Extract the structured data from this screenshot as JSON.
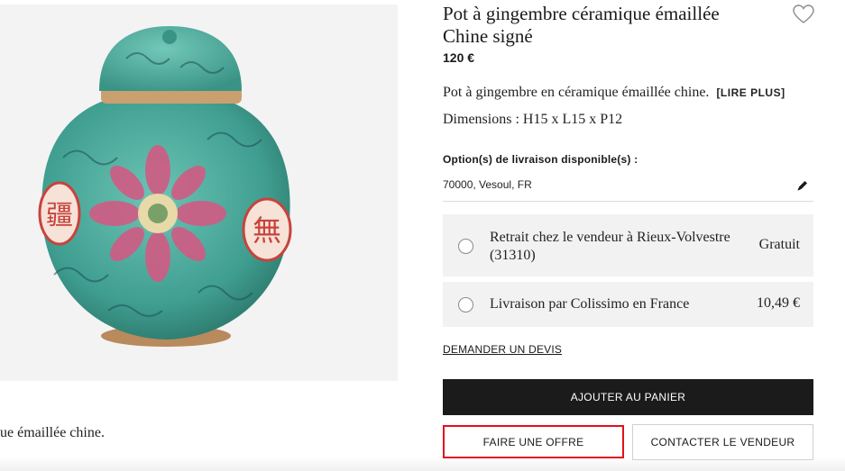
{
  "product": {
    "title": "Pot à gingembre céramique émaillée Chine signé",
    "price": "120 €",
    "description": "Pot à gingembre en céramique émaillée chine.",
    "read_more": "[LIRE PLUS]",
    "dimensions": "Dimensions : H15 x L15 x P12",
    "description_snippet": "ue émaillée chine."
  },
  "delivery": {
    "label": "Option(s) de livraison disponible(s) :",
    "location": "70000, Vesoul, FR",
    "options": [
      {
        "label": "Retrait chez le vendeur à Rieux-Volvestre (31310)",
        "price": "Gratuit"
      },
      {
        "label": "Livraison par Colissimo en France",
        "price": "10,49 €"
      }
    ]
  },
  "actions": {
    "quote": "DEMANDER UN DEVIS",
    "add_to_cart": "AJOUTER AU PANIER",
    "make_offer": "FAIRE UNE OFFRE",
    "contact_seller": "CONTACTER LE VENDEUR"
  },
  "image_characters": {
    "left": "疆",
    "right": "無"
  },
  "colors": {
    "highlight": "#e3101a",
    "cart_button": "#1b1b1b",
    "option_bg": "#f2f2f2",
    "vase": "#49a99b"
  }
}
